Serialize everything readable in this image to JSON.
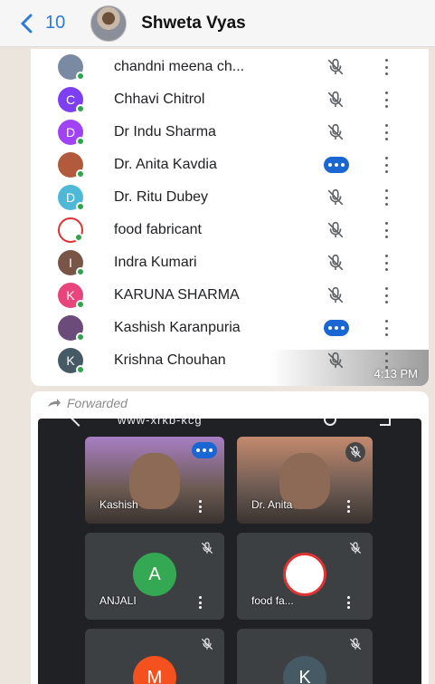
{
  "header": {
    "back_count": "10",
    "contact_name": "Shweta Vyas"
  },
  "participants": [
    {
      "name": "chandni meena ch...",
      "initial": "",
      "color": "#7b8aa3",
      "status": "muted"
    },
    {
      "name": "Chhavi Chitrol",
      "initial": "C",
      "color": "#7e3ff2",
      "status": "muted"
    },
    {
      "name": "Dr Indu Sharma",
      "initial": "D",
      "color": "#a142f4",
      "status": "muted"
    },
    {
      "name": "Dr. Anita Kavdia",
      "initial": "",
      "color": "#b25a3c",
      "status": "speaking"
    },
    {
      "name": "Dr. Ritu Dubey",
      "initial": "D",
      "color": "#4fb8d8",
      "status": "muted"
    },
    {
      "name": "food fabricant",
      "initial": "",
      "color": "#ffffff",
      "status": "muted"
    },
    {
      "name": "Indra Kumari",
      "initial": "I",
      "color": "#795548",
      "status": "muted"
    },
    {
      "name": "KARUNA SHARMA",
      "initial": "K",
      "color": "#e8457c",
      "status": "muted"
    },
    {
      "name": "Kashish Karanpuria",
      "initial": "",
      "color": "#6a4b7a",
      "status": "speaking"
    },
    {
      "name": "Krishna Chouhan",
      "initial": "K",
      "color": "#455a64",
      "status": "muted"
    }
  ],
  "message1": {
    "time": "4:13 PM"
  },
  "message2": {
    "forwarded_label": "Forwarded",
    "meet_title": "www-xrkb-kcg"
  },
  "tiles": [
    {
      "label": "Kashish",
      "initial": "",
      "color": "#a87fc4",
      "status": "speaking"
    },
    {
      "label": "Dr. Anita",
      "initial": "",
      "color": "#c48a6e",
      "status": "muted"
    },
    {
      "label": "ANJALI",
      "initial": "A",
      "color": "#34a853",
      "status": "muted"
    },
    {
      "label": "food fa...",
      "initial": "",
      "color": "#ffffff",
      "status": "muted"
    },
    {
      "label": "",
      "initial": "M",
      "color": "#f4511e",
      "status": "muted"
    },
    {
      "label": "",
      "initial": "K",
      "color": "#455a64",
      "status": "muted"
    }
  ],
  "icons": {
    "back": "chevron-left-icon",
    "mic_off": "mic-off-icon",
    "speaking": "speaking-indicator-icon",
    "more": "more-vert-icon",
    "forward": "forward-arrow-icon"
  }
}
